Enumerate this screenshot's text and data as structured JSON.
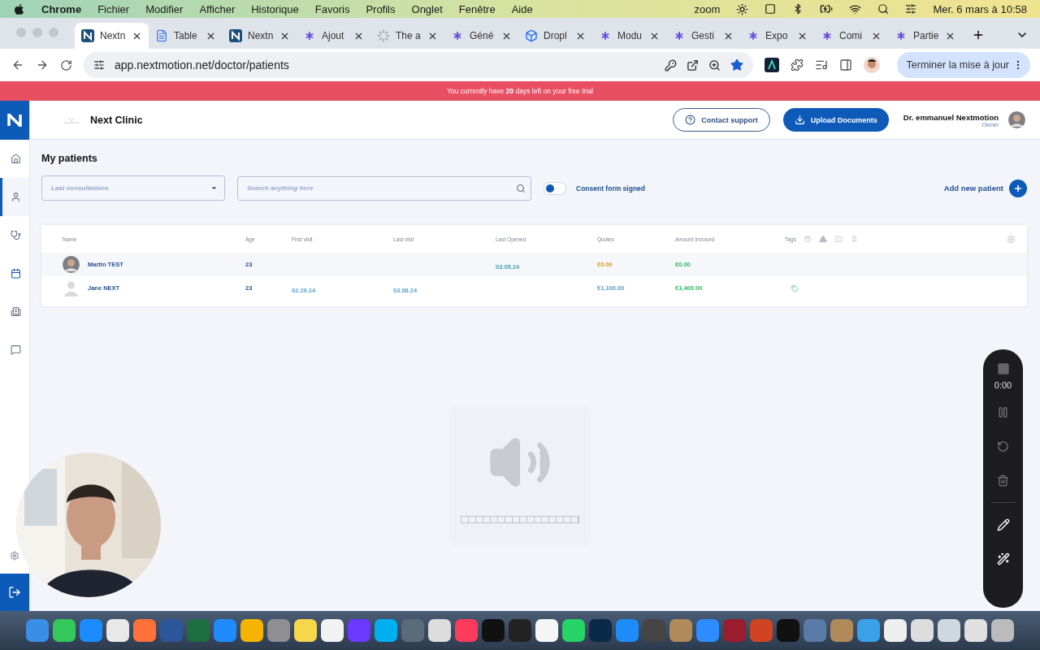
{
  "menubar": {
    "app": "Chrome",
    "menus": [
      "Fichier",
      "Modifier",
      "Afficher",
      "Historique",
      "Favoris",
      "Profils",
      "Onglet",
      "Fenêtre",
      "Aide"
    ],
    "status_text": "zoom",
    "clock": "Mer. 6 mars à 10:58"
  },
  "tabs": [
    {
      "title": "Nextn",
      "kind": "nextmotion",
      "selected": true
    },
    {
      "title": "Table",
      "kind": "doc",
      "selected": false
    },
    {
      "title": "Nextn",
      "kind": "nextmotion",
      "selected": false
    },
    {
      "title": "Ajout",
      "kind": "sparkle",
      "selected": false
    },
    {
      "title": "The a",
      "kind": "loading",
      "selected": false
    },
    {
      "title": "Géné",
      "kind": "sparkle",
      "selected": false
    },
    {
      "title": "Dropl",
      "kind": "box",
      "selected": false
    },
    {
      "title": "Modu",
      "kind": "sparkle",
      "selected": false
    },
    {
      "title": "Gesti",
      "kind": "sparkle",
      "selected": false
    },
    {
      "title": "Expo",
      "kind": "sparkle",
      "selected": false
    },
    {
      "title": "Comi",
      "kind": "sparkle",
      "selected": false
    },
    {
      "title": "Partie",
      "kind": "sparkle",
      "selected": false
    }
  ],
  "address": {
    "url": "app.nextmotion.net/doctor/patients",
    "bookmarked": true,
    "update_button": "Terminer la mise à jour"
  },
  "banner": "You currently have **20** days left on your free trial",
  "header": {
    "clinic": "Next Clinic",
    "contact": "Contact support",
    "upload": "Upload Documents",
    "user": "Dr. emmanuel Nextmotion",
    "role": "Owner"
  },
  "sidebar": {
    "items": [
      {
        "kind": "home",
        "selected": false
      },
      {
        "kind": "user",
        "selected": true
      },
      {
        "kind": "stethoscope",
        "selected": false
      },
      {
        "kind": "calendar",
        "selected": false
      },
      {
        "kind": "building",
        "selected": false
      },
      {
        "kind": "chat",
        "selected": false
      }
    ]
  },
  "page": {
    "title": "My patients",
    "filter_placeholder": "Last consultations",
    "search_placeholder": "Search anything here",
    "consent": {
      "label": "Consent form signed",
      "on": false
    },
    "add_button": "Add new patient"
  },
  "table": {
    "columns": [
      "Name",
      "Age",
      "First visit",
      "Last visit",
      "Last Opened",
      "Quotes",
      "Amount Invoiced",
      "Tags"
    ],
    "rows": [
      {
        "name": "Martin TEST",
        "photo": true,
        "age": "23",
        "last_opened": "03.05.24",
        "quotes": "€0.00",
        "color": "#e39a1c",
        "invoiced": "€0.00",
        "tag": false
      },
      {
        "name": "Jane NEXT",
        "photo": false,
        "age": "23",
        "first_visit": "02.29.24",
        "last_visit": "03.06.24",
        "quotes": "€1,100.00",
        "color": "#5a9fc9",
        "invoiced": "€1,400.00",
        "tag": true
      }
    ]
  },
  "recorder": {
    "time": "0:00"
  }
}
